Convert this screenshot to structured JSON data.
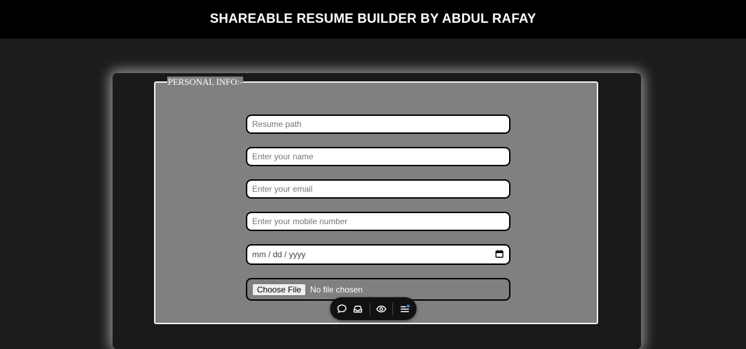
{
  "header": {
    "title": "SHAREABLE RESUME BUILDER BY ABDUL RAFAY"
  },
  "form": {
    "legend": "PERSONAL INFO:-",
    "fields": {
      "resume_path": {
        "placeholder": "Resume path"
      },
      "name": {
        "placeholder": "Enter your name"
      },
      "email": {
        "placeholder": "Enter your email"
      },
      "mobile": {
        "placeholder": "Enter your mobile number"
      },
      "date": {
        "placeholder": "mm / dd / yyyy",
        "icon": "calendar-icon"
      }
    },
    "file": {
      "button_label": "Choose File",
      "status": "No file chosen"
    }
  },
  "toolbar": {
    "icons": [
      "comment-icon",
      "inbox-icon",
      "eye-icon",
      "menu-icon"
    ],
    "accent": "#3b82f6"
  },
  "colors": {
    "page_bg": "#1c1c1c",
    "header_bg": "#000000",
    "fieldset_bg": "#808080"
  }
}
